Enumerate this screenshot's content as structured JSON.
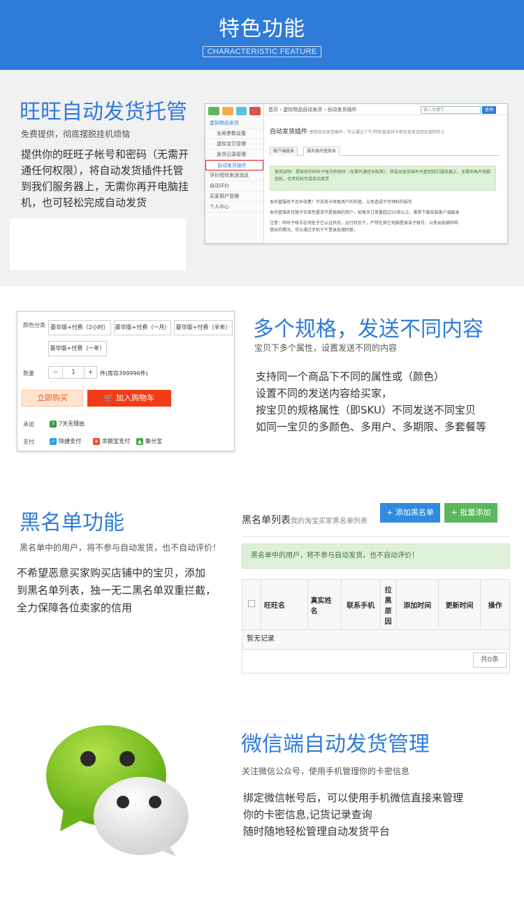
{
  "header": {
    "title": "特色功能",
    "subtitle": "CHARACTERISTIC FEATURE"
  },
  "section1": {
    "title": "旺旺自动发货托管",
    "tagline": "免费提供，彻底摆脱挂机烦恼",
    "body": [
      "提供你的旺旺子帐号和密码（无需开",
      "通任何权限），将自动发货插件托管",
      "到我们服务器上，无需你再开电脑挂",
      "机，也可轻松完成自动发货"
    ],
    "shot": {
      "menu": [
        "虚拟物品发货",
        "全局参数设置",
        "虚拟宝贝管理",
        "发货记录管理",
        "自动发货插件",
        "评价短信发送消息",
        "自动评价",
        "买家用户管理",
        "个人中心"
      ],
      "breadcrumb": "首页 › 虚拟物品自动发货 › 自动发货插件",
      "search_placeholder": "输入关键字...",
      "search_button": "查询",
      "heading": "自动发货插件",
      "heading_note": "使用自动发货插件，可以通过千牛/旺旺直接将卡密信息发送到买家旺旺上",
      "tabs": [
        "客户端版本",
        "服务器托管版本"
      ],
      "note": "使用说明：提供你的旺旺子帐号和密码（无需开通任何权限），将自动发货插件托管到我们服务器上，无需你再开电脑挂机，也可轻松完成自动发货",
      "lines": [
        "本托管服务不另外收费！不支持卡密类用户的托管，以免造成不可预料的损失",
        "本托管服务仅限于实效性要求不是很高的用户，如每天订单量超过50单以上，推荐下载安装客户端版本",
        "注意：旺旺子帐号必须处于已认证状态，运行状态下，严禁在其它电脑登录该子帐号，以免出现被旺旺",
        "登出的情况，可以通过手机千牛登录处理回复。"
      ]
    }
  },
  "section2": {
    "title": "多个规格，发送不同内容",
    "tagline": "宝贝下多个属性，设置发送不同的内容",
    "body": [
      "支持同一个商品下不同的属性或（颜色）",
      "设置不同的发送内容给买家，",
      "按宝贝的规格属性（即SKU）不同发送不同宝贝",
      "如同一宝贝的多颜色、多用户、多期限、多套餐等"
    ],
    "shot": {
      "color_label": "颜色分类",
      "options": [
        "豪华版+付费（2小时）",
        "豪华版+付费（一月）",
        "豪华版+付费（半年）",
        "豪华版+付费（一年）"
      ],
      "qty_label": "数量",
      "qty_minus": "−",
      "qty_value": "1",
      "qty_plus": "+",
      "stock": "件(库存399996件)",
      "buy_now": "立即购买",
      "add_cart": "加入购物车",
      "promise_label": "承诺",
      "promise": "7天无理由",
      "pay_label": "支付",
      "pay_methods": [
        "快捷支付",
        "余额宝支付",
        "集分宝"
      ]
    }
  },
  "section3": {
    "title": "黑名单功能",
    "tagline": "黑名单中的用户，将不参与自动发货，也不自动评价！",
    "body": [
      "不希望恶意买家购买店铺中的宝贝，添加",
      "到黑名单列表，独一无二黑名单双重拦截，",
      "全力保障各位卖家的信用"
    ],
    "shot": {
      "list_title": "黑名单列表",
      "list_sub": "我的淘宝买家黑名单列表",
      "add_button": "+ 添加黑名单",
      "batch_button": "+ 批量添加",
      "note": "黑名单中的用户，将不参与自动发货，也不自动评价！",
      "columns": [
        "旺旺名",
        "真实姓名",
        "联系手机",
        "拉黑原因",
        "添加时间",
        "更新时间",
        "操作"
      ],
      "empty": "暂无记录",
      "total": "共0条"
    }
  },
  "section4": {
    "title": "微信端自动发货管理",
    "tagline": "关注微信公众号，使用手机管理你的卡密信息",
    "body": [
      "绑定微信帐号后，可以使用手机微信直接来管理",
      "你的卡密信息,记货记录查询",
      "随时随地轻松管理自动发货平台"
    ]
  },
  "colors": {
    "header_bg": "#2f7bd9",
    "title_blue": "#2f7bd9",
    "section1_bg": "#f1f1f1",
    "note_green": "#dff0d8",
    "add_button": "#2f8ae0",
    "batch_button": "#5cb85c",
    "cart_red": "#f23c18"
  }
}
